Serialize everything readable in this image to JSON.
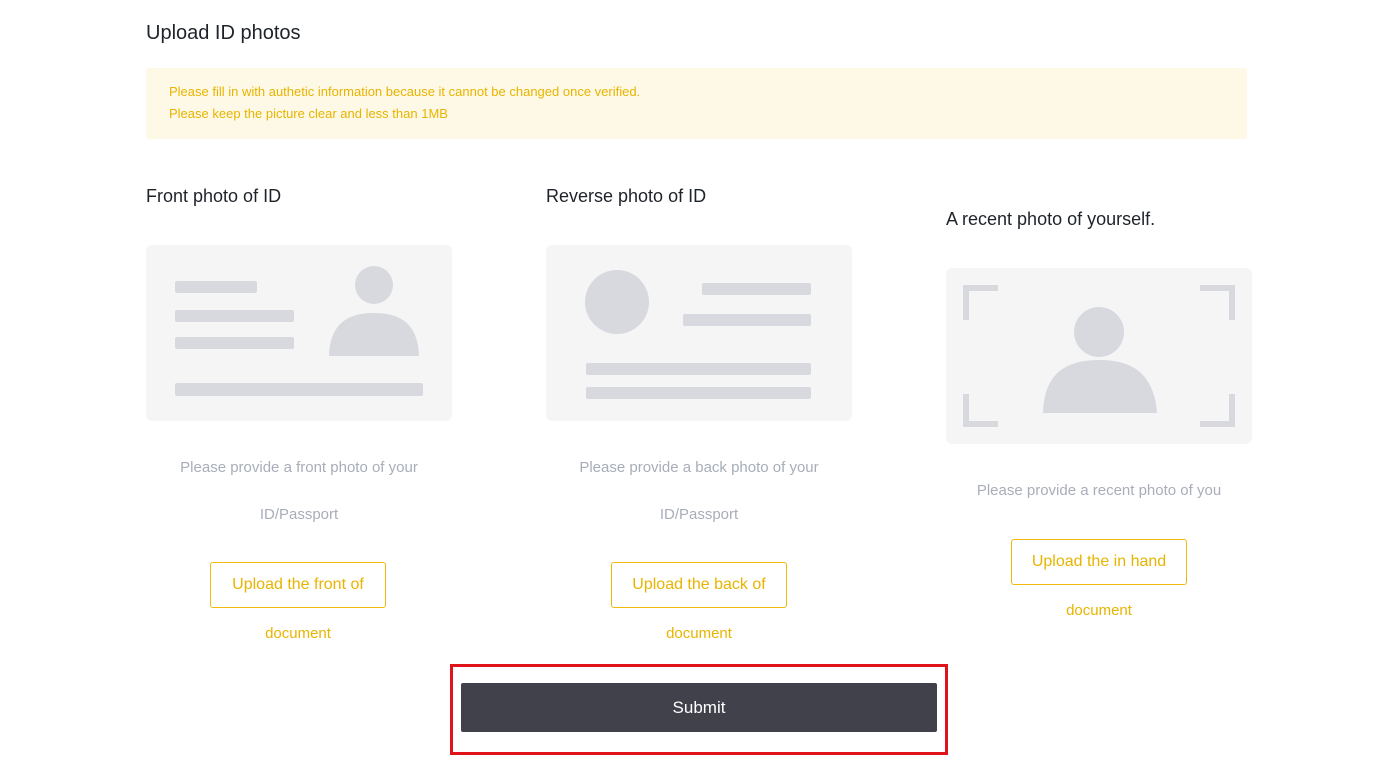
{
  "page": {
    "title": "Upload ID photos"
  },
  "notice": {
    "lines": [
      "Please fill in with authetic information because it cannot be changed once verified.",
      "Please keep the picture clear and less than 1MB"
    ]
  },
  "front": {
    "title": "Front photo of ID",
    "desc_line1": "Please provide a front photo of your",
    "desc_line2": "ID/Passport",
    "button_label": "Upload the front of",
    "button_tail": "document"
  },
  "back": {
    "title": "Reverse photo of ID",
    "desc_line1": "Please provide a back photo of your",
    "desc_line2": "ID/Passport",
    "button_label": "Upload the back of",
    "button_tail": "document"
  },
  "selfie": {
    "title": "A recent photo of yourself.",
    "desc_line1": "Please provide a recent photo of you",
    "button_label": "Upload the in hand",
    "button_tail": "document"
  },
  "submit": {
    "label": "Submit"
  },
  "colors": {
    "accent": "#f0b90b",
    "accent_text": "#e8b400",
    "notice_bg": "#fef9e6",
    "submit_bg": "#41414b",
    "highlight_frame": "#e0131b",
    "placeholder": "#d7d9df"
  }
}
